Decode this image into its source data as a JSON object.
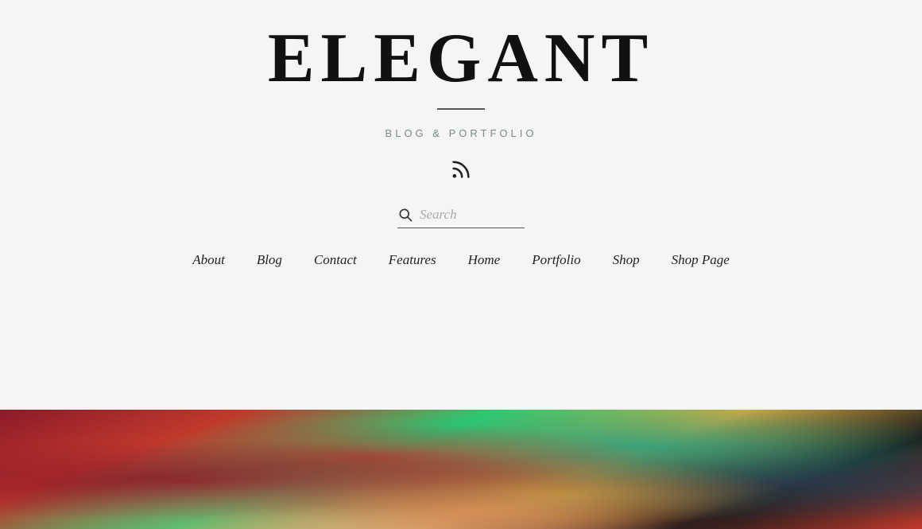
{
  "site": {
    "title": "ELEGANT",
    "subtitle": "BLOG & PORTFOLIO"
  },
  "search": {
    "placeholder": "Search"
  },
  "nav": {
    "items": [
      {
        "label": "About",
        "href": "#"
      },
      {
        "label": "Blog",
        "href": "#"
      },
      {
        "label": "Contact",
        "href": "#"
      },
      {
        "label": "Features",
        "href": "#"
      },
      {
        "label": "Home",
        "href": "#"
      },
      {
        "label": "Portfolio",
        "href": "#"
      },
      {
        "label": "Shop",
        "href": "#"
      },
      {
        "label": "Shop Page",
        "href": "#"
      }
    ]
  },
  "icons": {
    "rss": "⌘",
    "search": "🔍"
  }
}
